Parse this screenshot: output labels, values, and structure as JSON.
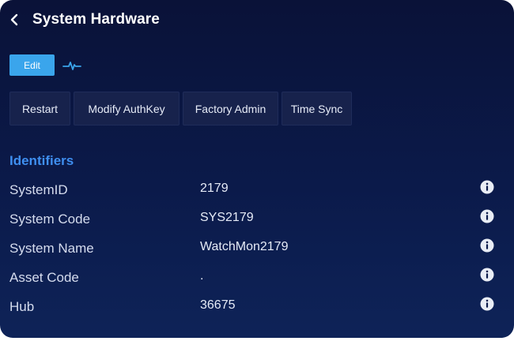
{
  "header": {
    "title": "System Hardware",
    "back_icon": "chevron-left-icon"
  },
  "toolbar": {
    "edit_label": "Edit",
    "pulse_icon": "pulse-icon",
    "edit_color": "#3aa5ec"
  },
  "actions": [
    {
      "label": "Restart"
    },
    {
      "label": "Modify AuthKey"
    },
    {
      "label": "Factory Admin"
    },
    {
      "label": "Time Sync"
    }
  ],
  "identifiers": {
    "title": "Identifiers",
    "title_color": "#3f8ff0",
    "rows": [
      {
        "label": "SystemID",
        "value": "2179"
      },
      {
        "label": "System Code",
        "value": "SYS2179"
      },
      {
        "label": "System Name",
        "value": "WatchMon2179"
      },
      {
        "label": "Asset Code",
        "value": "."
      },
      {
        "label": "Hub",
        "value": "36675"
      }
    ],
    "info_icon": "info-icon"
  }
}
